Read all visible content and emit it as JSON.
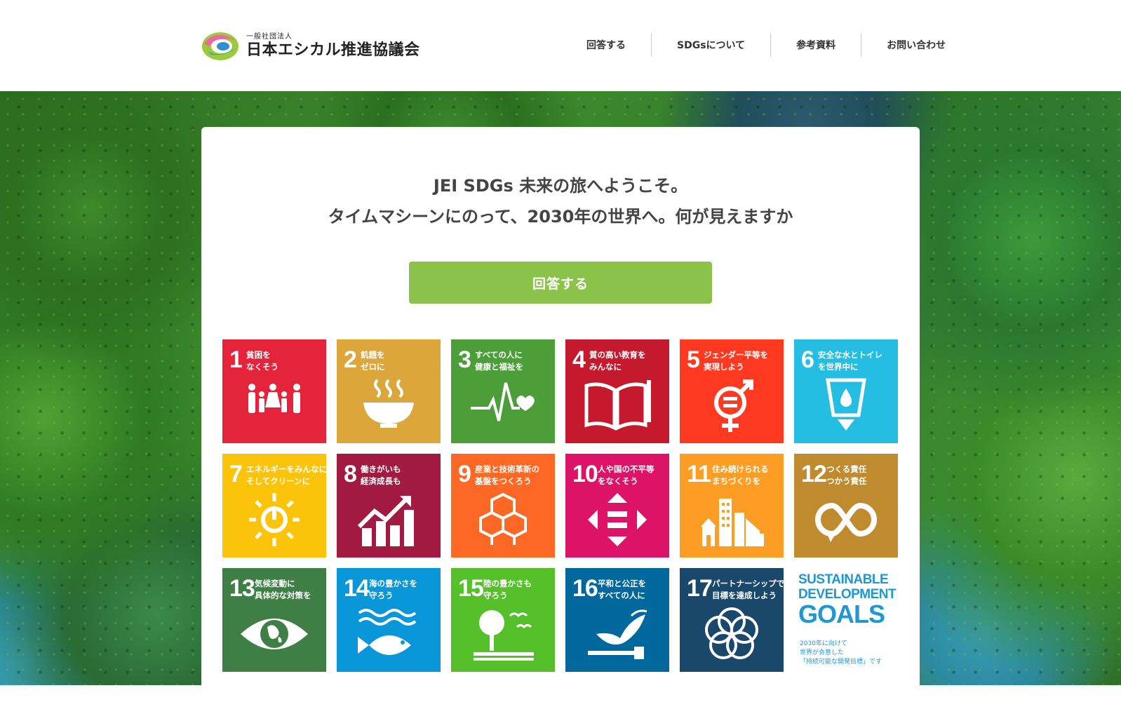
{
  "header": {
    "logo_sub": "一般社団法人",
    "logo_main": "日本エシカル推進協議会",
    "nav": [
      "回答する",
      "SDGsについて",
      "参考資料",
      "お問い合わせ"
    ]
  },
  "intro": {
    "line1": "JEI SDGs 未来の旅へようこそ。",
    "line2": "タイムマシーンにのって、2030年の世界へ。何が見えますか"
  },
  "cta_label": "回答する",
  "goals": [
    {
      "num": "1",
      "label": "貧困を\nなくそう",
      "color": "#e5243b",
      "icon": "people-icon"
    },
    {
      "num": "2",
      "label": "飢餓を\nゼロに",
      "color": "#dda63a",
      "icon": "bowl-icon"
    },
    {
      "num": "3",
      "label": "すべての人に\n健康と福祉を",
      "color": "#4c9f38",
      "icon": "heartbeat-icon"
    },
    {
      "num": "4",
      "label": "質の高い教育を\nみんなに",
      "color": "#c5192d",
      "icon": "book-icon"
    },
    {
      "num": "5",
      "label": "ジェンダー平等を\n実現しよう",
      "color": "#ff3a21",
      "icon": "gender-icon"
    },
    {
      "num": "6",
      "label": "安全な水とトイレ\nを世界中に",
      "color": "#26bde2",
      "icon": "water-icon"
    },
    {
      "num": "7",
      "label": "エネルギーをみんなに\nそしてクリーンに",
      "color": "#fcc30b",
      "icon": "sun-power-icon"
    },
    {
      "num": "8",
      "label": "働きがいも\n経済成長も",
      "color": "#a21942",
      "icon": "growth-chart-icon"
    },
    {
      "num": "9",
      "label": "産業と技術革新の\n基盤をつくろう",
      "color": "#fd6925",
      "icon": "cubes-icon"
    },
    {
      "num": "10",
      "label": "人や国の不平等\nをなくそう",
      "color": "#dd1367",
      "icon": "equality-arrows-icon"
    },
    {
      "num": "11",
      "label": "住み続けられる\nまちづくりを",
      "color": "#fd9d24",
      "icon": "city-icon"
    },
    {
      "num": "12",
      "label": "つくる責任\nつかう責任",
      "color": "#bf8b2e",
      "icon": "infinity-icon"
    },
    {
      "num": "13",
      "label": "気候変動に\n具体的な対策を",
      "color": "#3f7e44",
      "icon": "eye-globe-icon"
    },
    {
      "num": "14",
      "label": "海の豊かさを\n守ろう",
      "color": "#0a97d9",
      "icon": "fish-icon"
    },
    {
      "num": "15",
      "label": "陸の豊かさも\n守ろう",
      "color": "#56c02b",
      "icon": "tree-birds-icon"
    },
    {
      "num": "16",
      "label": "平和と公正を\nすべての人に",
      "color": "#00689d",
      "icon": "dove-icon"
    },
    {
      "num": "17",
      "label": "パートナーシップで\n目標を達成しよう",
      "color": "#19486a",
      "icon": "rings-icon"
    }
  ],
  "sdg_logo": {
    "line1": "SUSTAINABLE",
    "line2": "DEVELOPMENT",
    "line3": "GOALS",
    "caption": "2030年に向けて\n世界が合意した\n「持続可能な開発目標」です"
  }
}
